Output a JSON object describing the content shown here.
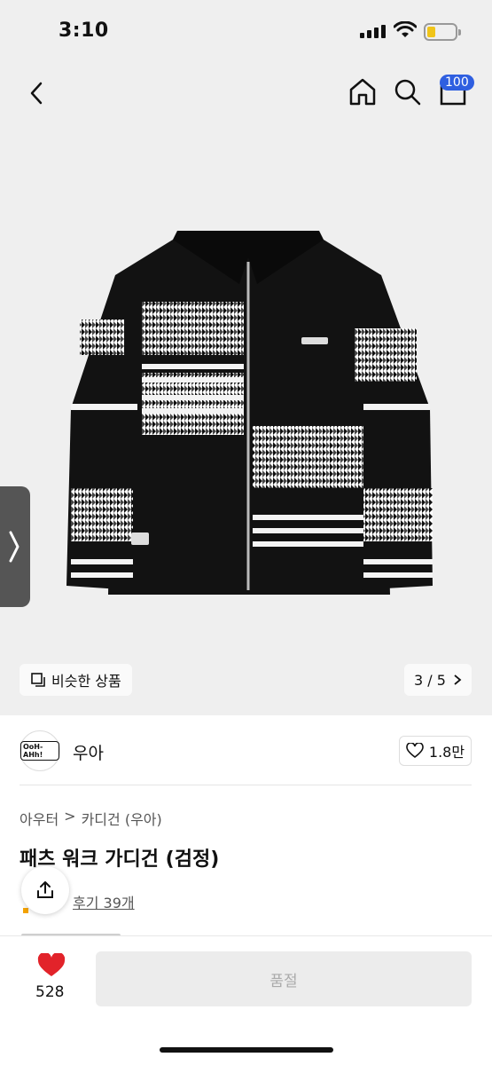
{
  "status": {
    "time": "3:10"
  },
  "nav": {
    "cart_count": "100"
  },
  "gallery": {
    "similar_label": "비슷한 상품",
    "pager": "3 / 5"
  },
  "brand": {
    "name": "우아",
    "logo_text": "OoH-AHh!",
    "likes": "1.8만"
  },
  "breadcrumb": {
    "level1": "아우터",
    "separator": ">",
    "level2": "카디건 (우아)"
  },
  "product": {
    "title": "패츠 워크 가디건 (검정)",
    "review_label": "후기 39개"
  },
  "bottom": {
    "favorite_count": "528",
    "soldout_label": "품절"
  },
  "colors": {
    "accent_badge": "#2f5fe0",
    "heart": "#e2232a",
    "star": "#f4a300"
  }
}
